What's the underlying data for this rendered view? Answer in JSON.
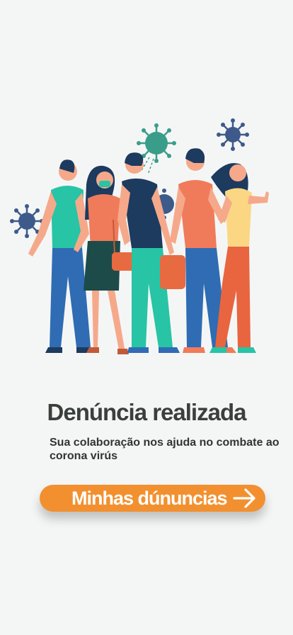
{
  "confirmation": {
    "title": "Denúncia realizada",
    "message": "Sua colaboração nos ajuda no combate ao corona virús"
  },
  "cta": {
    "label": "Minhas dúnuncias",
    "icon": "arrow-right-icon"
  },
  "illustration": {
    "description_icon": "people-virus-illustration"
  },
  "colors": {
    "background": "#f4f6f6",
    "accent": "#f2902f",
    "title": "#3a3f3c",
    "virus_blue": "#3d5a8a",
    "virus_green": "#3a9d8a"
  }
}
